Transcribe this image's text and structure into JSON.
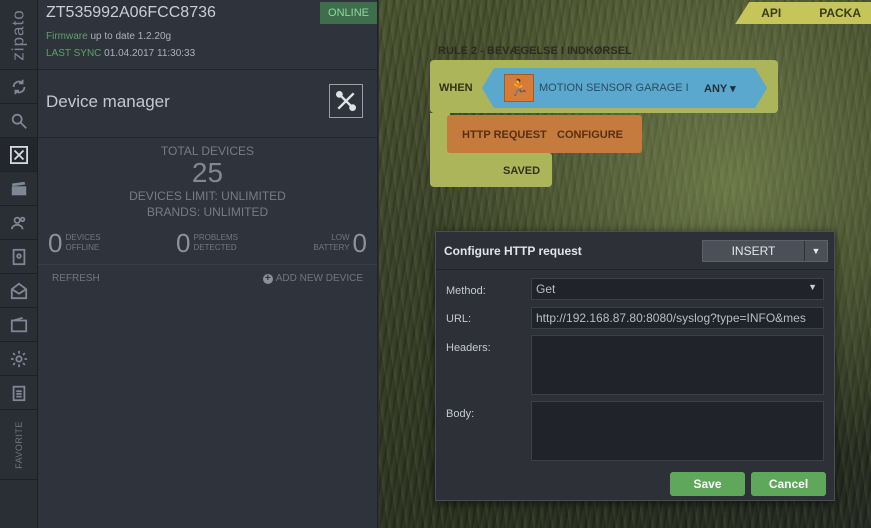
{
  "rail": {
    "logo": "zipato",
    "favorite": "FAVORITE"
  },
  "device": {
    "serial": "ZT535992A06FCC8736",
    "status": "ONLINE",
    "firmware_label": "Firmware",
    "firmware_text": "up to date 1.2.20g",
    "sync_label": "LAST SYNC",
    "sync_value": "01.04.2017 11:30:33"
  },
  "device_manager": {
    "title": "Device manager",
    "total_label": "TOTAL DEVICES",
    "total_value": "25",
    "limit": "DEVICES LIMIT: UNLIMITED",
    "brands": "BRANDS: UNLIMITED",
    "offline_count": "0",
    "offline_l1": "DEVICES",
    "offline_l2": "OFFLINE",
    "problems_count": "0",
    "problems_l1": "PROBLEMS",
    "problems_l2": "DETECTED",
    "battery_count": "0",
    "battery_l1": "LOW",
    "battery_l2": "BATTERY",
    "refresh": "REFRESH",
    "add": "ADD NEW DEVICE"
  },
  "tabs": [
    "API",
    "PACKA"
  ],
  "rule": {
    "title": "RULE 2 - BEVÆGELSE I INDKØRSEL",
    "when": "WHEN",
    "sensor_name": "MOTION SENSOR GARAGE I",
    "any": "ANY",
    "http": "HTTP REQUEST",
    "configure": "CONFIGURE",
    "saved": "SAVED"
  },
  "modal": {
    "title": "Configure HTTP request",
    "insert": "INSERT",
    "method_label": "Method:",
    "method_value": "Get",
    "url_label": "URL:",
    "url_value": "http://192.168.87.80:8080/syslog?type=INFO&mes",
    "headers_label": "Headers:",
    "body_label": "Body:",
    "save": "Save",
    "cancel": "Cancel"
  }
}
